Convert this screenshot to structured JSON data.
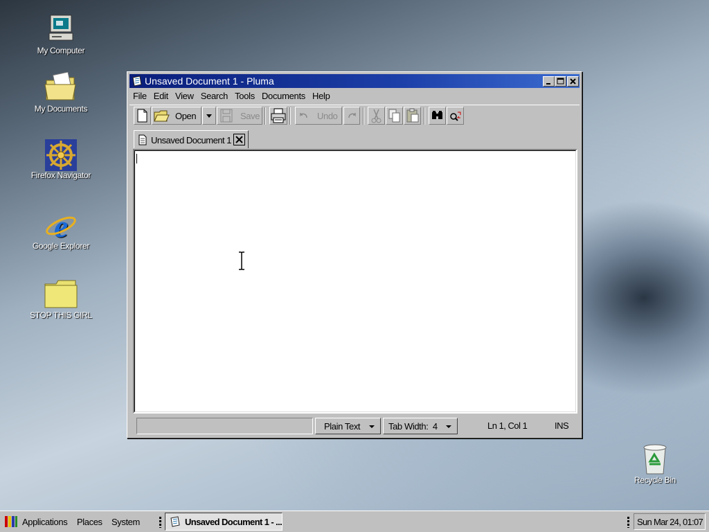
{
  "desktop": {
    "icons": [
      {
        "label": "My Computer",
        "icon": "computer-icon"
      },
      {
        "label": "My Documents",
        "icon": "documents-folder-icon"
      },
      {
        "label": "Firefox Navigator",
        "icon": "ship-wheel-icon"
      },
      {
        "label": "Google Explorer",
        "icon": "ie-icon"
      },
      {
        "label": "STOP THIS GIRL",
        "icon": "folder-icon"
      },
      {
        "label": "Recycle Bin",
        "icon": "recycle-bin-icon"
      }
    ]
  },
  "window": {
    "title": "Unsaved Document 1 - Pluma",
    "menu": [
      "File",
      "Edit",
      "View",
      "Search",
      "Tools",
      "Documents",
      "Help"
    ],
    "toolbar": {
      "open_label": "Open",
      "save_label": "Save",
      "undo_label": "Undo"
    },
    "tab_label": "Unsaved Document 1",
    "status": {
      "language": "Plain Text",
      "tab_width": "Tab Width:  4",
      "position": "Ln 1, Col 1",
      "mode": "INS"
    }
  },
  "taskbar": {
    "applications": "Applications",
    "places": "Places",
    "system": "System",
    "task_label": "Unsaved Document 1 - ...",
    "clock": "Sun Mar 24, 01:07"
  },
  "colors": {
    "titlebar": "#0a1e7a",
    "face": "#c0c0c0"
  }
}
